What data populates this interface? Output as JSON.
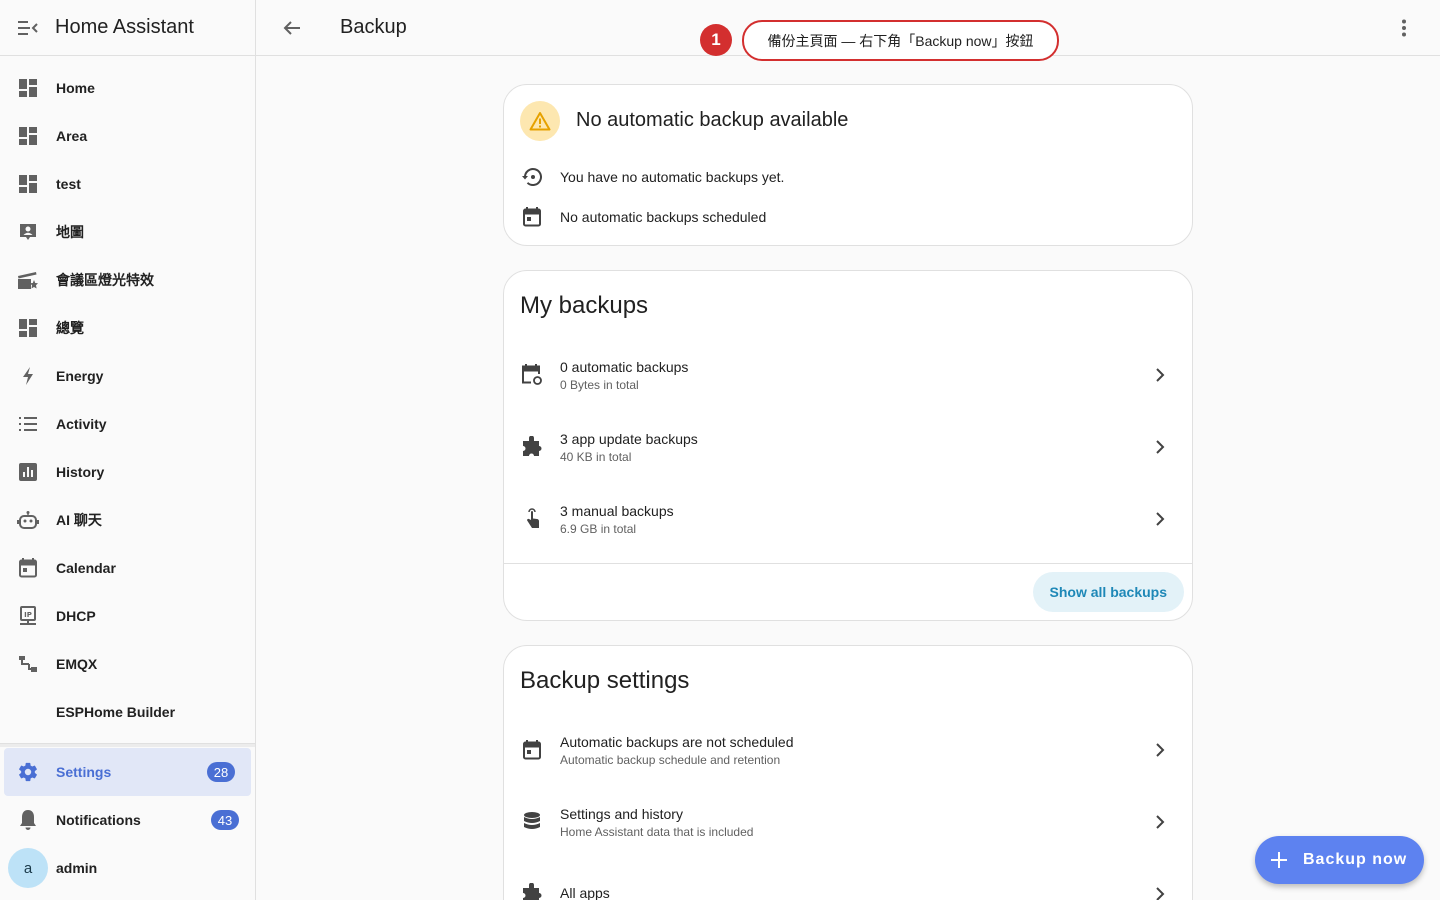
{
  "app": {
    "title": "Home Assistant"
  },
  "sidebar": {
    "items": [
      {
        "label": "Home",
        "icon": "dashboard-icon"
      },
      {
        "label": "Area",
        "icon": "dashboard-icon"
      },
      {
        "label": "test",
        "icon": "dashboard-icon"
      },
      {
        "label": "地圖",
        "icon": "map-account-icon"
      },
      {
        "label": "會議區燈光特效",
        "icon": "movie-open-star-icon"
      },
      {
        "label": "總覽",
        "icon": "dashboard-icon"
      },
      {
        "label": "Energy",
        "icon": "lightning-bolt-icon"
      },
      {
        "label": "Activity",
        "icon": "format-list-bulleted-icon"
      },
      {
        "label": "History",
        "icon": "chart-box-icon"
      },
      {
        "label": "AI 聊天",
        "icon": "robot-icon"
      },
      {
        "label": "Calendar",
        "icon": "calendar-icon"
      },
      {
        "label": "DHCP",
        "icon": "ip-network-icon"
      },
      {
        "label": "EMQX",
        "icon": "sitemap-icon"
      },
      {
        "label": "ESPHome Builder",
        "icon": ""
      }
    ],
    "settings": {
      "label": "Settings",
      "badge": "28"
    },
    "notifications": {
      "label": "Notifications",
      "badge": "43"
    },
    "user": {
      "label": "admin",
      "initial": "a"
    }
  },
  "topbar": {
    "title": "Backup"
  },
  "callout": {
    "step": "1",
    "text": "備份主頁面 — 右下角「Backup now」按鈕"
  },
  "status_card": {
    "headline": "No automatic backup available",
    "rows": [
      "You have no automatic backups yet.",
      "No automatic backups scheduled"
    ]
  },
  "my_backups": {
    "title": "My backups",
    "rows": [
      {
        "primary": "0 automatic backups",
        "secondary": "0 Bytes in total"
      },
      {
        "primary": "3 app update backups",
        "secondary": "40 KB in total"
      },
      {
        "primary": "3 manual backups",
        "secondary": "6.9 GB in total"
      }
    ],
    "show_all_label": "Show all backups"
  },
  "backup_settings": {
    "title": "Backup settings",
    "rows": [
      {
        "primary": "Automatic backups are not scheduled",
        "secondary": "Automatic backup schedule and retention"
      },
      {
        "primary": "Settings and history",
        "secondary": "Home Assistant data that is included"
      },
      {
        "primary": "All apps",
        "secondary": ""
      }
    ]
  },
  "fab": {
    "label": "Backup now"
  },
  "colors": {
    "accent": "#4a6fd4",
    "fab": "#5d82f0",
    "callout": "#d32f2f",
    "warning": "#fde7b0"
  }
}
